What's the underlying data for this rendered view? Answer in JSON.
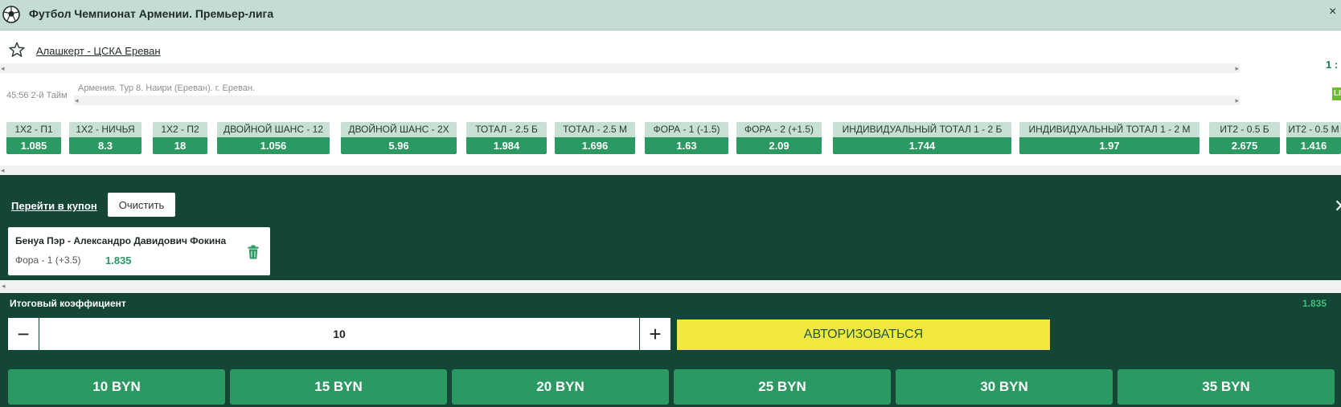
{
  "header": {
    "title": "Футбол Чемпионат Армении. Премьер-лига",
    "close": "×"
  },
  "match": {
    "name": "Алашкерт - ЦСКА Ереван",
    "score": "1 :",
    "time": "45:56 2-й Тайм",
    "info": "Армения. Тур 8. Наири (Ереван). г. Ереван.",
    "live": "LI"
  },
  "markets": [
    {
      "label": "1X2 - П1",
      "value": "1.085"
    },
    {
      "label": "1X2 - НИЧЬЯ",
      "value": "8.3"
    },
    {
      "label": "1X2 - П2",
      "value": "18"
    },
    {
      "label": "ДВОЙНОЙ ШАНС - 12",
      "value": "1.056"
    },
    {
      "label": "ДВОЙНОЙ ШАНС - 2X",
      "value": "5.96"
    },
    {
      "label": "ТОТАЛ - 2.5 Б",
      "value": "1.984"
    },
    {
      "label": "ТОТАЛ - 2.5 М",
      "value": "1.696"
    },
    {
      "label": "ФОРА - 1 (-1.5)",
      "value": "1.63"
    },
    {
      "label": "ФОРА - 2 (+1.5)",
      "value": "2.09"
    },
    {
      "label": "ИНДИВИДУАЛЬНЫЙ ТОТАЛ 1 - 2 Б",
      "value": "1.744"
    },
    {
      "label": "ИНДИВИДУАЛЬНЫЙ ТОТАЛ 1 - 2 М",
      "value": "1.97"
    },
    {
      "label": "ИТ2 - 0.5 Б",
      "value": "2.675"
    },
    {
      "label": "ИТ2 - 0.5 М",
      "value": "1.416"
    }
  ],
  "coupon": {
    "go_label": "Перейти в купон",
    "clear_label": "Очистить",
    "close": "✕",
    "bet": {
      "teams": "Бенуа Пэр - Александро Давидович Фокина",
      "outcome": "Фора - 1 (+3.5)",
      "odd": "1.835"
    },
    "total_label": "Итоговый коэффициент",
    "total_value": "1.835",
    "stake": "10",
    "minus": "−",
    "plus": "+",
    "auth_label": "АВТОРИЗОВАТЬСЯ",
    "quick_amounts": [
      "10 BYN",
      "15 BYN",
      "20 BYN",
      "25 BYN",
      "30 BYN",
      "35 BYN"
    ]
  },
  "colors": {
    "accent": "#2b9a62",
    "dark": "#134636",
    "yellow": "#f2e83e",
    "header": "#c4dcd2"
  }
}
